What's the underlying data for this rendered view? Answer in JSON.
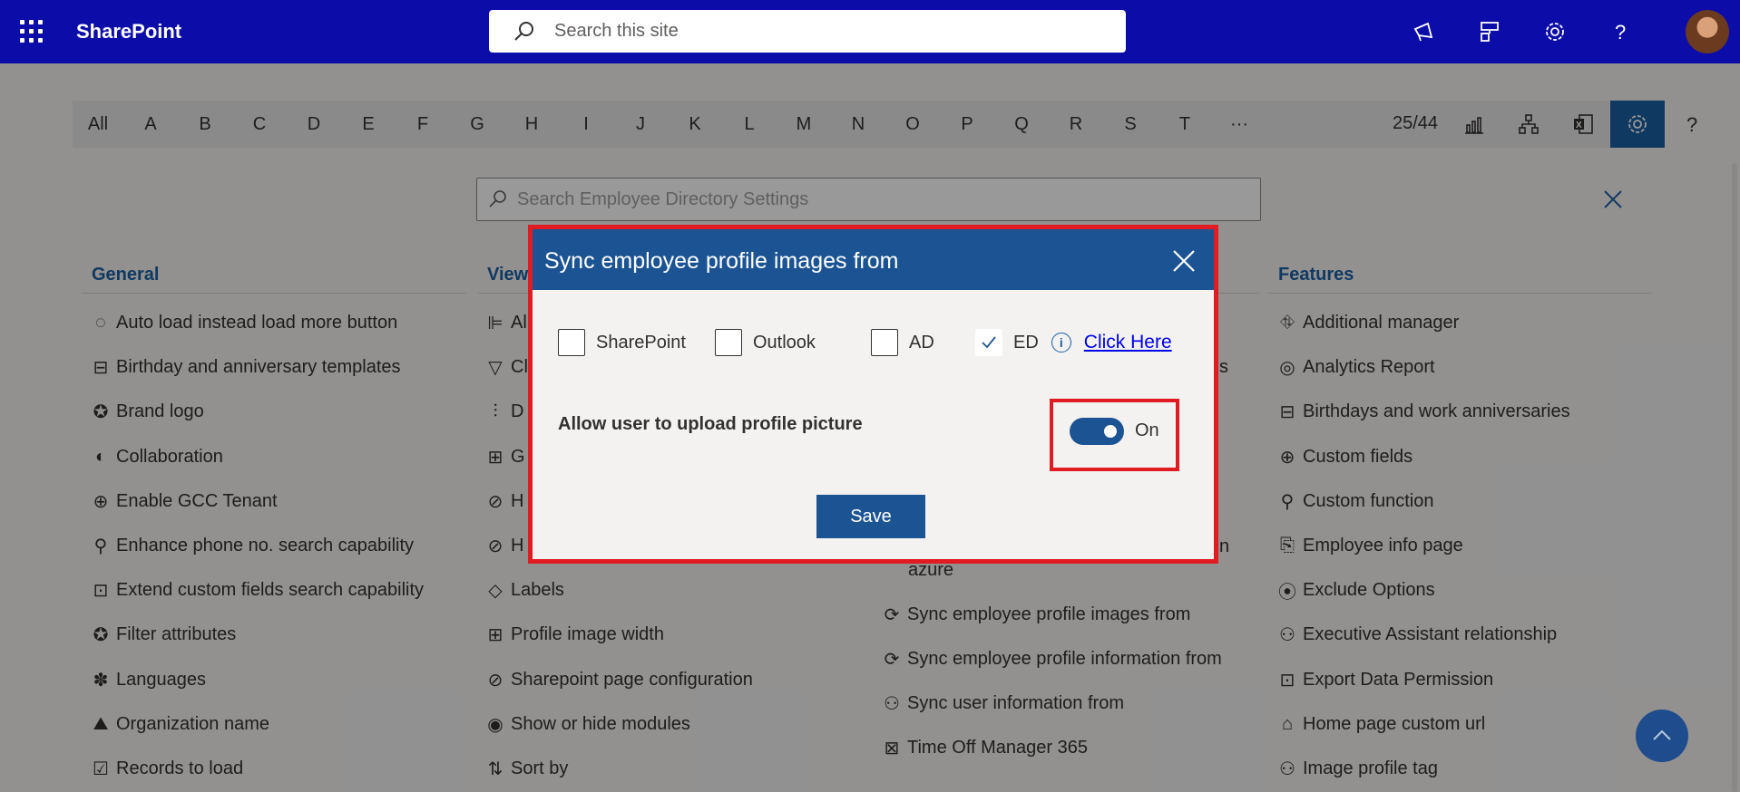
{
  "suitebar": {
    "brand": "SharePoint",
    "search_placeholder": "Search this site"
  },
  "letterbar": {
    "letters": [
      "All",
      "A",
      "B",
      "C",
      "D",
      "E",
      "F",
      "G",
      "H",
      "I",
      "J",
      "K",
      "L",
      "M",
      "N",
      "O",
      "P",
      "Q",
      "R",
      "S",
      "T",
      "···"
    ],
    "counter": "25/44"
  },
  "settings_search": {
    "placeholder": "Search Employee Directory Settings"
  },
  "columns": {
    "general": {
      "heading": "General",
      "items": [
        "Auto load instead load more button",
        "Birthday and anniversary templates",
        "Brand logo",
        "Collaboration",
        "Enable GCC Tenant",
        "Enhance phone no. search capability",
        "Extend custom fields search capability",
        "Filter attributes",
        "Languages",
        "Organization name",
        "Records to load"
      ]
    },
    "view": {
      "heading": "View",
      "items": [
        "Al",
        "Cl",
        "D",
        "G",
        "H",
        "H",
        "Labels",
        "Profile image width",
        "Sharepoint page configuration",
        "Show or hide modules",
        "Sort by"
      ]
    },
    "sync": {
      "partial_right": [
        "s",
        "n"
      ],
      "items": [
        "azure",
        "Sync employee profile images from",
        "Sync employee profile information from",
        "Sync user information from",
        "Time Off Manager 365"
      ]
    },
    "features": {
      "heading": "Features",
      "items": [
        "Additional manager",
        "Analytics Report",
        "Birthdays and work anniversaries",
        "Custom fields",
        "Custom function",
        "Employee info page",
        "Exclude Options",
        "Executive Assistant relationship",
        "Export Data Permission",
        "Home page custom url",
        "Image profile tag"
      ]
    }
  },
  "dialog": {
    "title": "Sync employee profile images from",
    "options": [
      {
        "label": "SharePoint",
        "checked": false
      },
      {
        "label": "Outlook",
        "checked": false
      },
      {
        "label": "AD",
        "checked": false
      },
      {
        "label": "ED",
        "checked": true
      }
    ],
    "click_here": "Click Here",
    "allow_label": "Allow user to upload profile picture",
    "toggle_state": "On",
    "save_label": "Save"
  },
  "colors": {
    "suitebar": "#0c0ca8",
    "accent": "#1b5393",
    "highlight": "#e11b22"
  }
}
